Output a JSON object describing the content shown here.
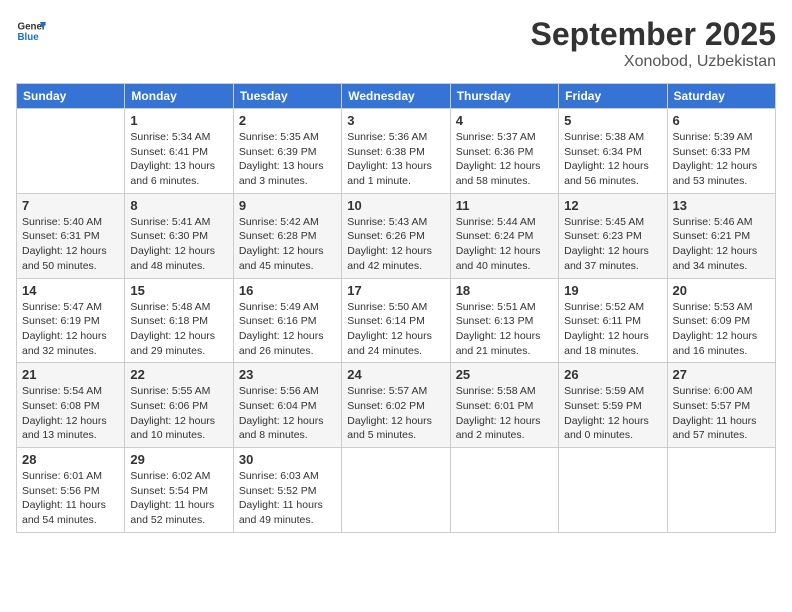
{
  "header": {
    "logo_general": "General",
    "logo_blue": "Blue",
    "month_title": "September 2025",
    "location": "Xonobod, Uzbekistan"
  },
  "days_of_week": [
    "Sunday",
    "Monday",
    "Tuesday",
    "Wednesday",
    "Thursday",
    "Friday",
    "Saturday"
  ],
  "weeks": [
    [
      {
        "day": "",
        "info": ""
      },
      {
        "day": "1",
        "info": "Sunrise: 5:34 AM\nSunset: 6:41 PM\nDaylight: 13 hours\nand 6 minutes."
      },
      {
        "day": "2",
        "info": "Sunrise: 5:35 AM\nSunset: 6:39 PM\nDaylight: 13 hours\nand 3 minutes."
      },
      {
        "day": "3",
        "info": "Sunrise: 5:36 AM\nSunset: 6:38 PM\nDaylight: 13 hours\nand 1 minute."
      },
      {
        "day": "4",
        "info": "Sunrise: 5:37 AM\nSunset: 6:36 PM\nDaylight: 12 hours\nand 58 minutes."
      },
      {
        "day": "5",
        "info": "Sunrise: 5:38 AM\nSunset: 6:34 PM\nDaylight: 12 hours\nand 56 minutes."
      },
      {
        "day": "6",
        "info": "Sunrise: 5:39 AM\nSunset: 6:33 PM\nDaylight: 12 hours\nand 53 minutes."
      }
    ],
    [
      {
        "day": "7",
        "info": "Sunrise: 5:40 AM\nSunset: 6:31 PM\nDaylight: 12 hours\nand 50 minutes."
      },
      {
        "day": "8",
        "info": "Sunrise: 5:41 AM\nSunset: 6:30 PM\nDaylight: 12 hours\nand 48 minutes."
      },
      {
        "day": "9",
        "info": "Sunrise: 5:42 AM\nSunset: 6:28 PM\nDaylight: 12 hours\nand 45 minutes."
      },
      {
        "day": "10",
        "info": "Sunrise: 5:43 AM\nSunset: 6:26 PM\nDaylight: 12 hours\nand 42 minutes."
      },
      {
        "day": "11",
        "info": "Sunrise: 5:44 AM\nSunset: 6:24 PM\nDaylight: 12 hours\nand 40 minutes."
      },
      {
        "day": "12",
        "info": "Sunrise: 5:45 AM\nSunset: 6:23 PM\nDaylight: 12 hours\nand 37 minutes."
      },
      {
        "day": "13",
        "info": "Sunrise: 5:46 AM\nSunset: 6:21 PM\nDaylight: 12 hours\nand 34 minutes."
      }
    ],
    [
      {
        "day": "14",
        "info": "Sunrise: 5:47 AM\nSunset: 6:19 PM\nDaylight: 12 hours\nand 32 minutes."
      },
      {
        "day": "15",
        "info": "Sunrise: 5:48 AM\nSunset: 6:18 PM\nDaylight: 12 hours\nand 29 minutes."
      },
      {
        "day": "16",
        "info": "Sunrise: 5:49 AM\nSunset: 6:16 PM\nDaylight: 12 hours\nand 26 minutes."
      },
      {
        "day": "17",
        "info": "Sunrise: 5:50 AM\nSunset: 6:14 PM\nDaylight: 12 hours\nand 24 minutes."
      },
      {
        "day": "18",
        "info": "Sunrise: 5:51 AM\nSunset: 6:13 PM\nDaylight: 12 hours\nand 21 minutes."
      },
      {
        "day": "19",
        "info": "Sunrise: 5:52 AM\nSunset: 6:11 PM\nDaylight: 12 hours\nand 18 minutes."
      },
      {
        "day": "20",
        "info": "Sunrise: 5:53 AM\nSunset: 6:09 PM\nDaylight: 12 hours\nand 16 minutes."
      }
    ],
    [
      {
        "day": "21",
        "info": "Sunrise: 5:54 AM\nSunset: 6:08 PM\nDaylight: 12 hours\nand 13 minutes."
      },
      {
        "day": "22",
        "info": "Sunrise: 5:55 AM\nSunset: 6:06 PM\nDaylight: 12 hours\nand 10 minutes."
      },
      {
        "day": "23",
        "info": "Sunrise: 5:56 AM\nSunset: 6:04 PM\nDaylight: 12 hours\nand 8 minutes."
      },
      {
        "day": "24",
        "info": "Sunrise: 5:57 AM\nSunset: 6:02 PM\nDaylight: 12 hours\nand 5 minutes."
      },
      {
        "day": "25",
        "info": "Sunrise: 5:58 AM\nSunset: 6:01 PM\nDaylight: 12 hours\nand 2 minutes."
      },
      {
        "day": "26",
        "info": "Sunrise: 5:59 AM\nSunset: 5:59 PM\nDaylight: 12 hours\nand 0 minutes."
      },
      {
        "day": "27",
        "info": "Sunrise: 6:00 AM\nSunset: 5:57 PM\nDaylight: 11 hours\nand 57 minutes."
      }
    ],
    [
      {
        "day": "28",
        "info": "Sunrise: 6:01 AM\nSunset: 5:56 PM\nDaylight: 11 hours\nand 54 minutes."
      },
      {
        "day": "29",
        "info": "Sunrise: 6:02 AM\nSunset: 5:54 PM\nDaylight: 11 hours\nand 52 minutes."
      },
      {
        "day": "30",
        "info": "Sunrise: 6:03 AM\nSunset: 5:52 PM\nDaylight: 11 hours\nand 49 minutes."
      },
      {
        "day": "",
        "info": ""
      },
      {
        "day": "",
        "info": ""
      },
      {
        "day": "",
        "info": ""
      },
      {
        "day": "",
        "info": ""
      }
    ]
  ]
}
